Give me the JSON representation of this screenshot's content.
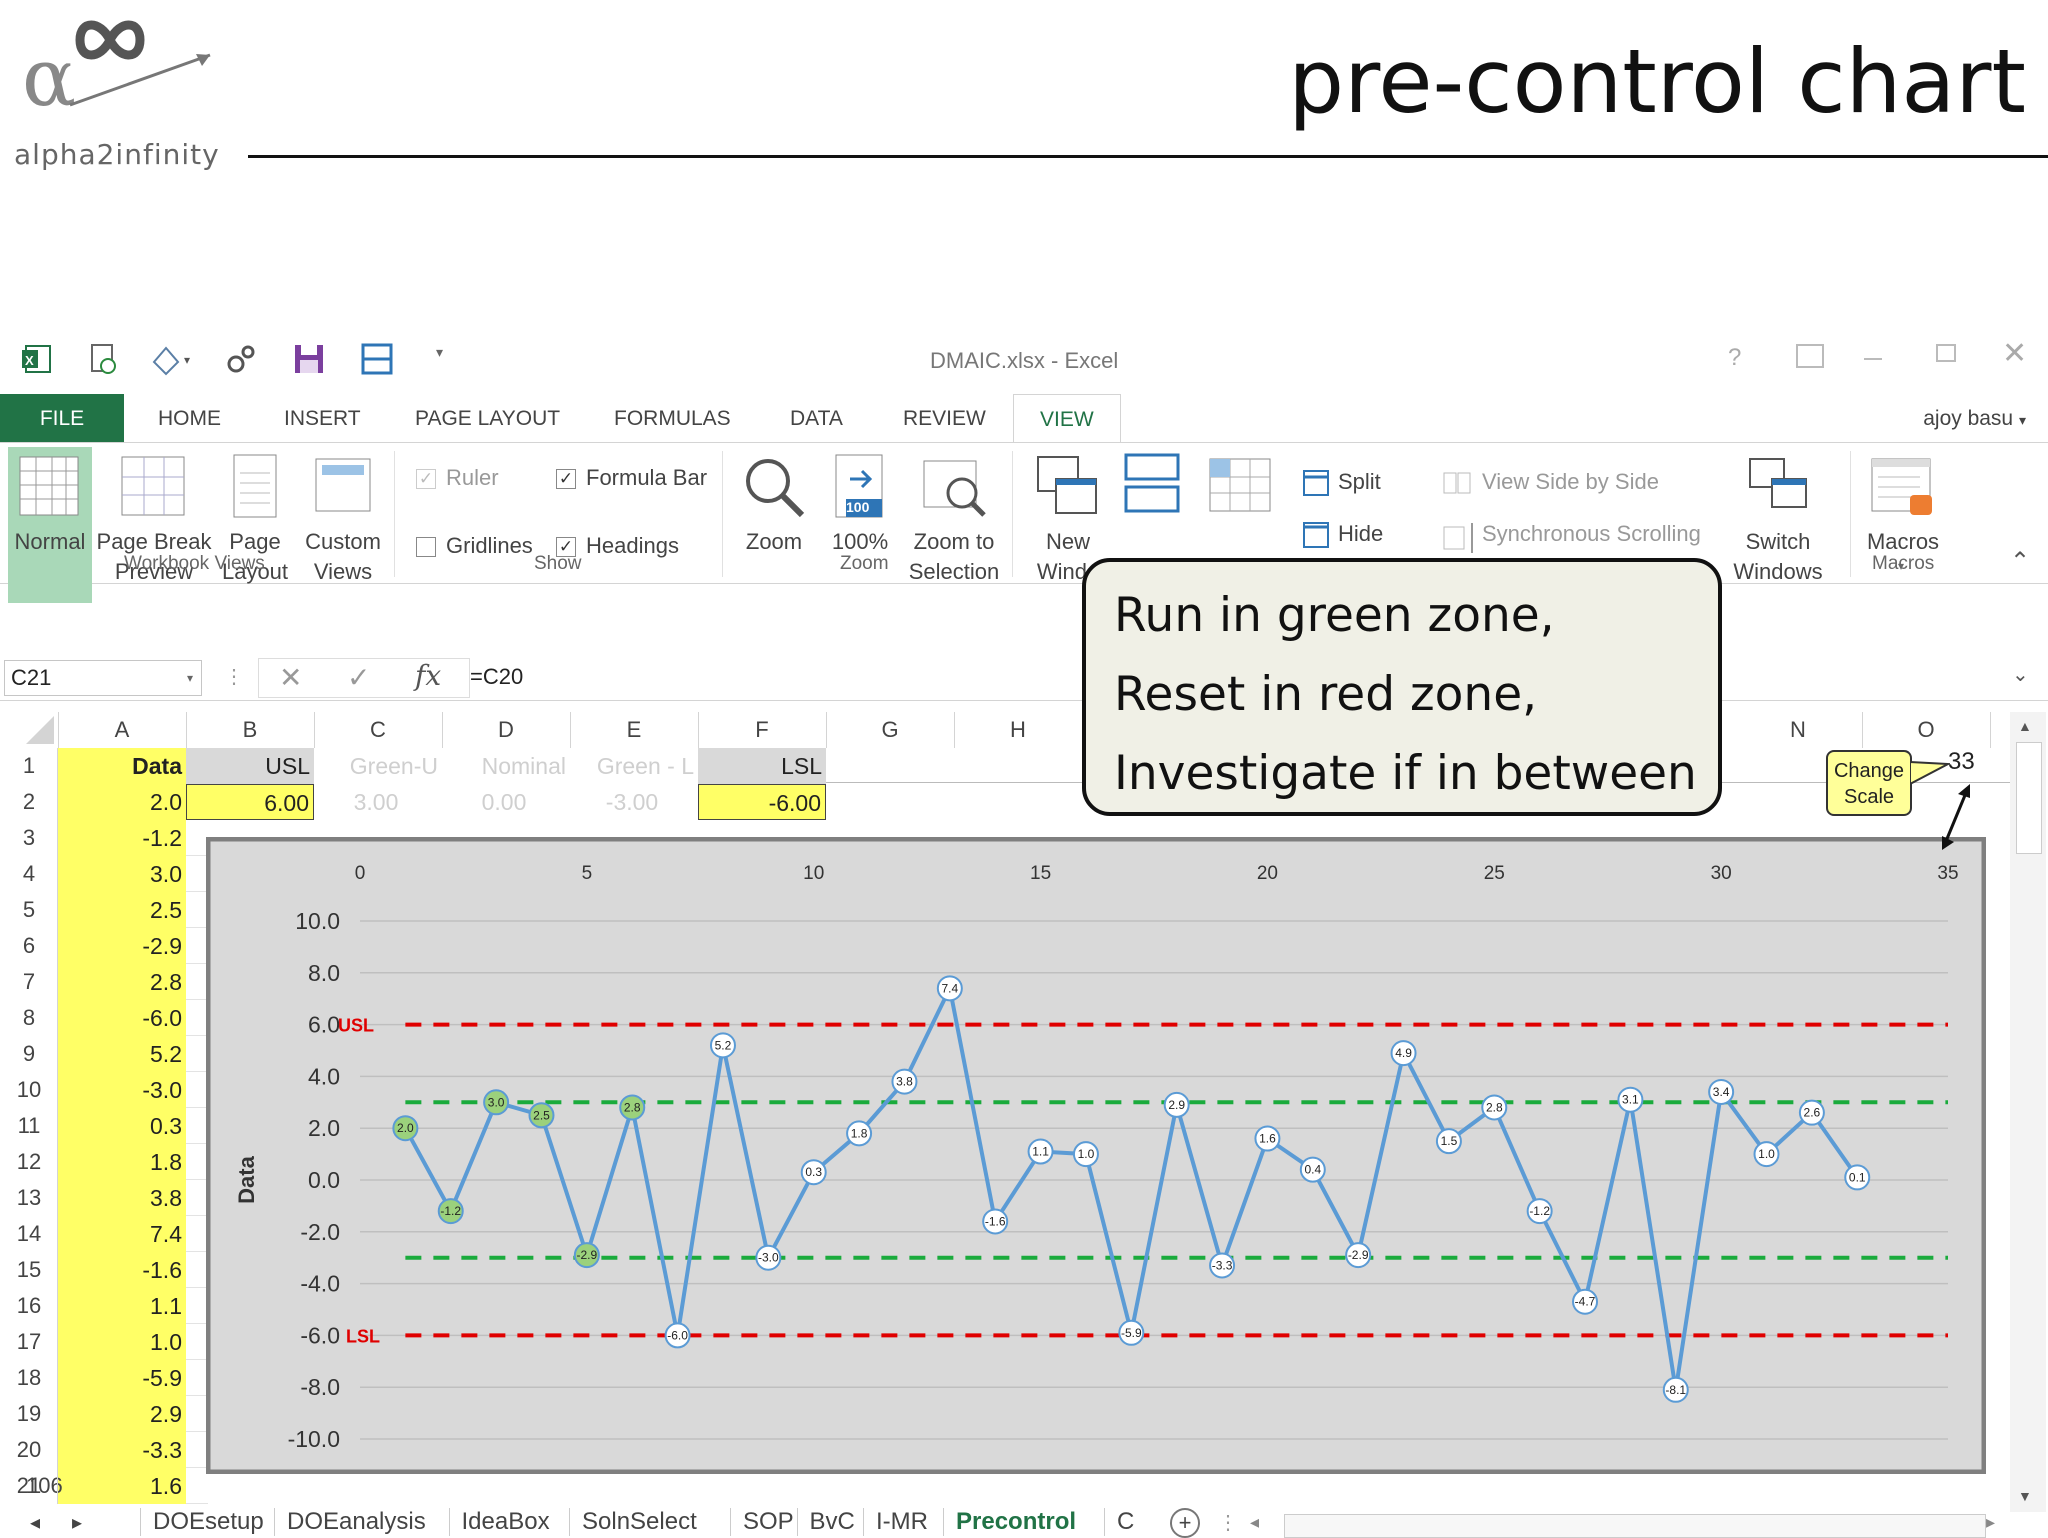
{
  "slide": {
    "title": "pre-control chart",
    "logo_text": "alpha2infinity"
  },
  "window": {
    "title": "DMAIC.xlsx - Excel",
    "user": "ajoy basu",
    "help": "?",
    "controls": "⌃ – ❐ ✕"
  },
  "ribbon_tabs": [
    "FILE",
    "HOME",
    "INSERT",
    "PAGE LAYOUT",
    "FORMULAS",
    "DATA",
    "REVIEW",
    "VIEW"
  ],
  "ribbon": {
    "workbook_views": {
      "group": "Workbook Views",
      "normal": "Normal",
      "page_break_1": "Page Break",
      "page_break_2": "Preview",
      "page_layout_1": "Page",
      "page_layout_2": "Layout",
      "custom_views_1": "Custom",
      "custom_views_2": "Views"
    },
    "show": {
      "group": "Show",
      "ruler": "Ruler",
      "formula_bar": "Formula Bar",
      "gridlines": "Gridlines",
      "headings": "Headings"
    },
    "zoom": {
      "group": "Zoom",
      "zoom": "Zoom",
      "hundred": "100%",
      "hundred_badge": "100",
      "zoom_sel_1": "Zoom to",
      "zoom_sel_2": "Selection"
    },
    "window": {
      "new_window_1": "New",
      "new_window_2": "Windo",
      "split": "Split",
      "hide": "Hide",
      "side_by_side": "View Side by Side",
      "sync_scroll": "Synchronous Scrolling",
      "switch_1": "Switch",
      "switch_2": "Windows"
    },
    "macros": {
      "group": "Macros",
      "label": "Macros"
    }
  },
  "formula_bar": {
    "name_box": "C21",
    "formula": "=C20"
  },
  "columns": [
    "A",
    "B",
    "C",
    "D",
    "E",
    "F",
    "G",
    "H",
    "N",
    "O"
  ],
  "header_row": {
    "A": "Data",
    "B": "USL",
    "C": "Green-U",
    "D": "Nominal",
    "E": "Green - L",
    "F": "LSL"
  },
  "row2": {
    "B": "6.00",
    "C": "3.00",
    "D": "0.00",
    "E": "-3.00",
    "F": "-6.00"
  },
  "data_column": [
    "2.0",
    "-1.2",
    "3.0",
    "2.5",
    "-2.9",
    "2.8",
    "-6.0",
    "5.2",
    "-3.0",
    "0.3",
    "1.8",
    "3.8",
    "7.4",
    "-1.6",
    "1.1",
    "1.0",
    "-5.9",
    "2.9",
    "-3.3",
    "1.6"
  ],
  "row_numbers": [
    "1",
    "2",
    "3",
    "4",
    "5",
    "6",
    "7",
    "8",
    "9",
    "10",
    "11",
    "12",
    "13",
    "14",
    "15",
    "16",
    "17",
    "18",
    "19",
    "20",
    "21"
  ],
  "row21_overlay": "106",
  "callout": {
    "line1": "Run in green zone,",
    "line2": "Reset in red zone,",
    "line3": "Investigate if in between"
  },
  "change_scale": {
    "line1": "Change",
    "line2": "Scale",
    "value": "33"
  },
  "sheet_tabs": [
    "DOEsetup",
    "DOEanalysis",
    "IdeaBox",
    "SolnSelect",
    "SOP",
    "BvC",
    "I-MR",
    "Precontrol",
    "C"
  ],
  "chart_data": {
    "type": "line",
    "ylabel": "Data",
    "xlim": [
      0,
      35
    ],
    "x_ticks": [
      0,
      5,
      10,
      15,
      20,
      25,
      30,
      35
    ],
    "ylim": [
      -10,
      10
    ],
    "y_ticks": [
      "10.0",
      "8.0",
      "6.0",
      "4.0",
      "2.0",
      "0.0",
      "-2.0",
      "-4.0",
      "-6.0",
      "-8.0",
      "-10.0"
    ],
    "usl_label": "USL",
    "lsl_label": "LSL",
    "limits": {
      "usl": 6.0,
      "green_upper": 3.0,
      "green_lower": -3.0,
      "lsl": -6.0
    },
    "x": [
      1,
      2,
      3,
      4,
      5,
      6,
      7,
      8,
      9,
      10,
      11,
      12,
      13,
      14,
      15,
      16,
      17,
      18,
      19,
      20,
      21,
      22,
      23,
      24,
      25,
      26,
      27,
      28,
      29,
      30,
      31,
      32,
      33
    ],
    "values": [
      2.0,
      -1.2,
      3.0,
      2.5,
      -2.9,
      2.8,
      -6.0,
      5.2,
      -3.0,
      0.3,
      1.8,
      3.8,
      7.4,
      -1.6,
      1.1,
      1.0,
      -5.9,
      2.9,
      -3.3,
      1.6,
      0.4,
      -2.9,
      4.9,
      1.5,
      2.8,
      -1.2,
      -4.7,
      3.1,
      -8.1,
      3.4,
      1.0,
      2.6,
      0.1
    ],
    "labels": [
      "2.0",
      "-1.2",
      "3.0",
      "2.5",
      "-2.9",
      "2.8",
      "-6.0",
      "5.2",
      "-3.0",
      "0.3",
      "1.8",
      "3.8",
      "7.4",
      "-1.6",
      "1.1",
      "1.0",
      "-5.9",
      "2.9",
      "-3.3",
      "1.6",
      "0.4",
      "-2.9",
      "4.9",
      "1.5",
      "2.8",
      "-1.2",
      "-4.7",
      "3.1",
      "-8.1",
      "3.4",
      "1.0",
      "2.6",
      "0.1"
    ],
    "green_marked_points": [
      1,
      2,
      3,
      4,
      5,
      6
    ],
    "colors": {
      "line": "#5b9bd5",
      "red_limit": "#e00000",
      "green_limit": "#1aab3c",
      "green_marker": "#9bd17c",
      "plot_bg": "#ffffff",
      "chart_bg": "#d9d9d9"
    },
    "grid": true
  }
}
